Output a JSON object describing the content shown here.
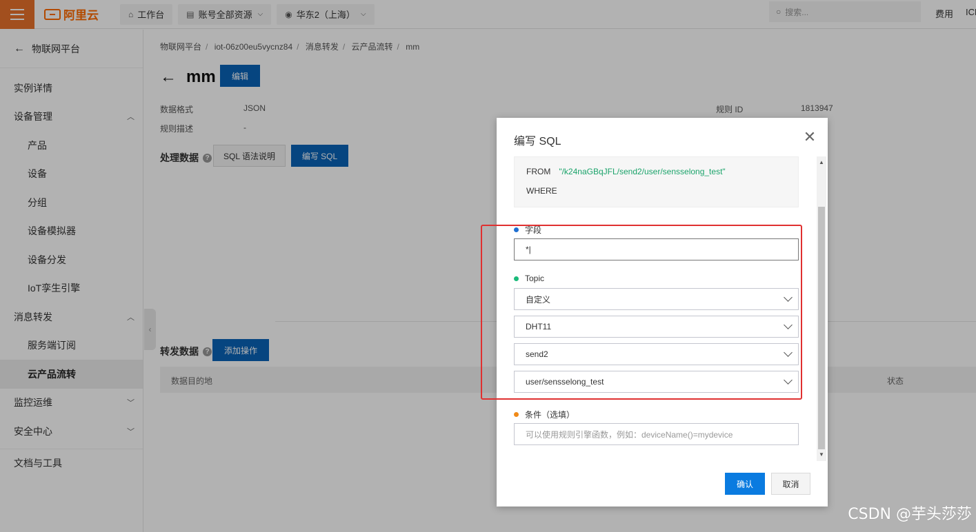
{
  "topbar": {
    "brand": "阿里云",
    "workbench": "工作台",
    "resources": "账号全部资源",
    "region": "华东2（上海）",
    "search_placeholder": "搜索...",
    "fee": "费用",
    "icp": "ICP"
  },
  "sidebar": {
    "back_label": "物联网平台",
    "items": [
      {
        "label": "实例详情"
      },
      {
        "label": "设备管理"
      },
      {
        "label": "产品"
      },
      {
        "label": "设备"
      },
      {
        "label": "分组"
      },
      {
        "label": "设备模拟器"
      },
      {
        "label": "设备分发"
      },
      {
        "label": "IoT孪生引擎"
      },
      {
        "label": "消息转发"
      },
      {
        "label": "服务端订阅"
      },
      {
        "label": "云产品流转"
      },
      {
        "label": "监控运维"
      },
      {
        "label": "安全中心"
      },
      {
        "label": "文档与工具"
      }
    ]
  },
  "breadcrumb": [
    "物联网平台",
    "iot-06z00eu5vycnz84",
    "消息转发",
    "云产品流转",
    "mm"
  ],
  "page": {
    "title": "mm",
    "edit_label": "编辑",
    "data_format_label": "数据格式",
    "data_format_value": "JSON",
    "rule_desc_label": "规则描述",
    "rule_desc_value": "-",
    "rule_id_label": "规则 ID",
    "rule_id_value": "1813947",
    "process_label": "处理数据",
    "sql_help_label": "SQL 语法说明",
    "write_sql_label": "编写 SQL",
    "forward_label": "转发数据",
    "add_action_label": "添加操作",
    "col_destination": "数据目的地",
    "col_status": "状态"
  },
  "modal": {
    "title": "编写 SQL",
    "sql_from_kw": "FROM",
    "sql_from_topic": "\"/k24naGBqJFL/send2/user/sensselong_test\"",
    "sql_where_kw": "WHERE",
    "field_label": "字段",
    "field_value": "*|",
    "topic_label": "Topic",
    "topic_type": "自定义",
    "product": "DHT11",
    "device": "send2",
    "topic_path": "user/sensselong_test",
    "condition_label": "条件（选填）",
    "condition_placeholder": "可以使用规则引擎函数，例如：deviceName()=mydevice",
    "ok_label": "确认",
    "cancel_label": "取消"
  },
  "watermark": "CSDN @芋头莎莎",
  "colors": {
    "brand": "#ff6a00",
    "primary": "#0a63b8",
    "confirm": "#0a7be0",
    "field_dot": "#1f6fd1",
    "topic_dot": "#1aba7a",
    "condition_dot": "#f08a18",
    "highlight": "#e03030"
  }
}
